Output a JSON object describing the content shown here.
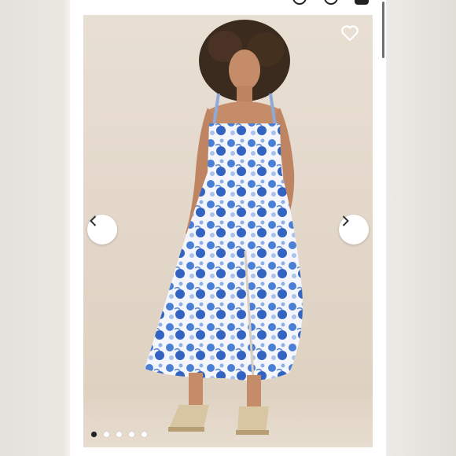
{
  "screen": {
    "title": "",
    "product_image": {
      "alt": "",
      "current_index": 1,
      "total_images": 5
    }
  },
  "icons": {
    "favorite": "heart-outline-icon",
    "previous": "chevron-left-icon",
    "next": "chevron-right-icon",
    "search": "search-icon",
    "account": "account-icon",
    "bag": "bag-icon"
  },
  "colors": {
    "page_background": "#ffffff",
    "photo_backdrop": "#e2d6c8",
    "dress_primary": "#ffffff",
    "dress_print": "#3a6fd0",
    "dot_active": "#222222",
    "dot_inactive": "#ffffff"
  }
}
